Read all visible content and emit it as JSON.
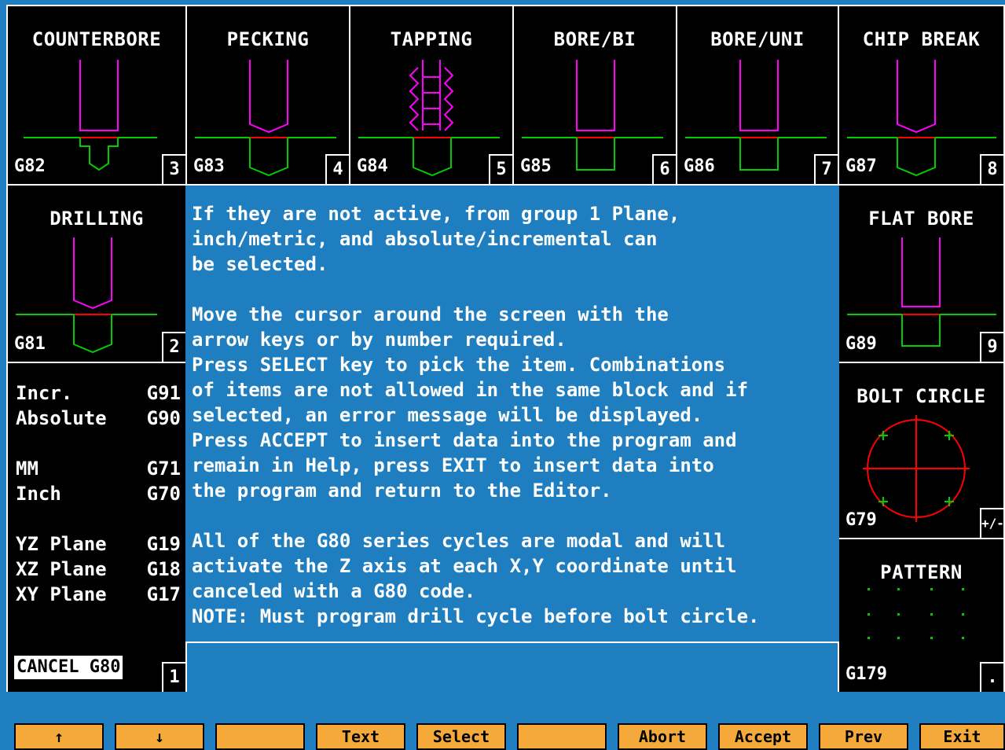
{
  "cycles": [
    {
      "title": "COUNTERBORE",
      "code": "G82",
      "num": "3"
    },
    {
      "title": "PECKING",
      "code": "G83",
      "num": "4"
    },
    {
      "title": "TAPPING",
      "code": "G84",
      "num": "5"
    },
    {
      "title": "BORE/BI",
      "code": "G85",
      "num": "6"
    },
    {
      "title": "BORE/UNI",
      "code": "G86",
      "num": "7"
    },
    {
      "title": "CHIP BREAK",
      "code": "G87",
      "num": "8"
    },
    {
      "title": "DRILLING",
      "code": "G81",
      "num": "2"
    },
    {
      "title": "FLAT BORE",
      "code": "G89",
      "num": "9"
    },
    {
      "title": "BOLT CIRCLE",
      "code": "G79",
      "num": "+/-"
    },
    {
      "title": "PATTERN",
      "code": "G179",
      "num": "."
    }
  ],
  "modes": {
    "incr": {
      "label": "Incr.",
      "code": "G91"
    },
    "absolute": {
      "label": "Absolute",
      "code": "G90"
    },
    "mm": {
      "label": "MM",
      "code": "G71"
    },
    "inch": {
      "label": "Inch",
      "code": "G70"
    },
    "yz": {
      "label": "YZ Plane",
      "code": "G19"
    },
    "xz": {
      "label": "XZ Plane",
      "code": "G18"
    },
    "xy": {
      "label": "XY Plane",
      "code": "G17"
    },
    "cancel": {
      "label": "CANCEL G80",
      "num": "1"
    }
  },
  "help_lines": [
    "If they are not active, from group 1 Plane,",
    "inch/metric, and absolute/incremental can",
    "be selected.",
    "",
    "Move the cursor around the screen with the",
    "arrow keys or by number required.",
    "Press SELECT key to pick the item. Combinations",
    "of items are not allowed in the same block and if",
    "selected, an error message will be displayed.",
    "Press ACCEPT to insert data into the program and",
    "remain in Help, press EXIT to insert data into",
    "the program and return to the Editor.",
    "",
    "All of the G80 series cycles are modal and will",
    "activate the Z axis at each X,Y coordinate until",
    "canceled with a G80 code.",
    "NOTE: Must program drill cycle before bolt circle."
  ],
  "fkeys": [
    "↑",
    "↓",
    "",
    "Text",
    "Select",
    "",
    "Abort",
    "Accept",
    "Prev",
    "Exit"
  ],
  "colors": {
    "tool": "#ff00ff",
    "part": "#00cc00",
    "cut": "#ff0000",
    "bg": "#1e7ec0",
    "fkey": "#f6a93b"
  }
}
